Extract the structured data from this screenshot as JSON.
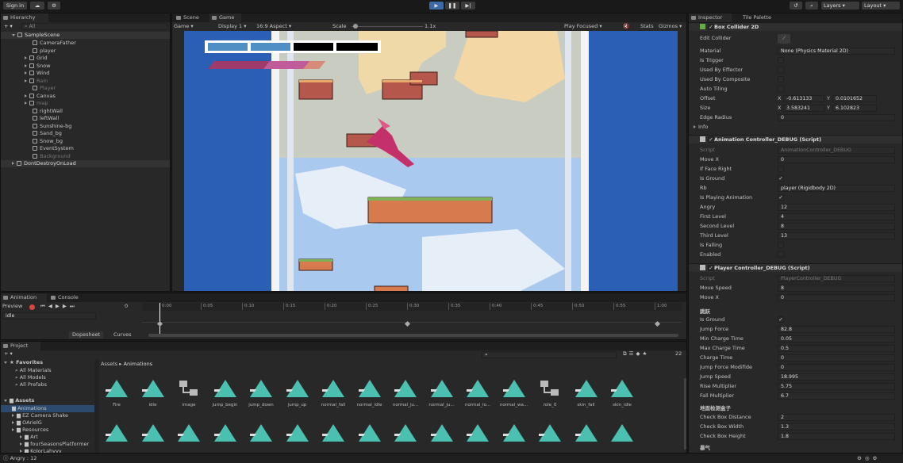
{
  "toolbar": {
    "signin": "Sign in",
    "layers": "Layers",
    "layout": "Layout"
  },
  "hierarchy": {
    "tab": "Hierarchy",
    "search": "All",
    "scene": "SampleScene",
    "items": [
      "CameraFather",
      "player",
      "Grid",
      "Snow",
      "Wind",
      "Rain",
      "Player",
      "Canvas",
      "map",
      "rightWall",
      "leftWall",
      "Sunshine-bg",
      "Sand_bg",
      "Snow_bg",
      "EventSystem",
      "Background"
    ],
    "dont_destroy": "DontDestroyOnLoad"
  },
  "game": {
    "tab_scene": "Scene",
    "tab_game": "Game",
    "mode": "Game",
    "display": "Display 1",
    "aspect": "16:9 Aspect",
    "scale_label": "Scale",
    "scale_value": "1.1x",
    "play_focused": "Play Focused",
    "stats": "Stats",
    "gizmos": "Gizmos"
  },
  "animation": {
    "tab_anim": "Animation",
    "tab_console": "Console",
    "preview": "Preview",
    "frame": "0",
    "clip": "idle",
    "ticks": [
      "0:00",
      "0:05",
      "0:10",
      "0:15",
      "0:20",
      "0:25",
      "0:30",
      "0:35",
      "0:40",
      "0:45",
      "0:50",
      "0:55",
      "1:00"
    ],
    "dopesheet": "Dopesheet",
    "curves": "Curves"
  },
  "project": {
    "tab": "Project",
    "count": "22",
    "favorites": "Favorites",
    "fav_items": [
      "All Materials",
      "All Models",
      "All Prefabs"
    ],
    "assets": "Assets",
    "tree": [
      "Animations",
      "EZ Camera Shake",
      "OArielG",
      "Resources",
      "Art",
      "fourSeasonsPlatformer",
      "KolorLahyyy"
    ],
    "breadcrumb_root": "Assets",
    "breadcrumb_leaf": "Animations",
    "asset_names": [
      "Fire",
      "idle",
      "image",
      "jump_begin",
      "jump_down",
      "jump_up",
      "normal_fall",
      "normal_idle",
      "normal_ju...",
      "normal_ju...",
      "normal_lo...",
      "normal_wa...",
      "role_0",
      "skin_fall",
      "skin_idle"
    ]
  },
  "inspector": {
    "tab": "Inspector",
    "tab2": "Tile Palette",
    "box_collider": {
      "title": "Box Collider 2D",
      "edit": "Edit Collider",
      "material_label": "Material",
      "material": "None (Physics Material 2D)",
      "is_trigger": "Is Trigger",
      "used_effector": "Used By Effector",
      "used_composite": "Used By Composite",
      "auto_tiling": "Auto Tiling",
      "offset": "Offset",
      "offset_x": "-0.613133",
      "offset_y": "0.0101652",
      "size": "Size",
      "size_x": "3.583241",
      "size_y": "6.102823",
      "edge_radius": "Edge Radius",
      "edge_radius_v": "0",
      "info": "Info"
    },
    "anim_ctrl": {
      "title": "Animation Controller_DEBUG (Script)",
      "script_label": "Script",
      "script": "AnimationController_DEBUG",
      "fields": [
        {
          "label": "Move X",
          "value": "0"
        },
        {
          "label": "If Face Right",
          "value": ""
        },
        {
          "label": "Is Ground",
          "value": "✓"
        },
        {
          "label": "Rb",
          "value": "player (Rigidbody 2D)"
        },
        {
          "label": "Is Playing Animation",
          "value": "✓"
        },
        {
          "label": "Angry",
          "value": "12"
        },
        {
          "label": "First Level",
          "value": "4"
        },
        {
          "label": "Second Level",
          "value": "8"
        },
        {
          "label": "Third Level",
          "value": "13"
        },
        {
          "label": "Is Falling",
          "value": ""
        },
        {
          "label": "Enabled",
          "value": ""
        }
      ]
    },
    "player_ctrl": {
      "title": "Player Controller_DEBUG (Script)",
      "script_label": "Script",
      "script": "PlayerController_DEBUG",
      "fields": [
        {
          "label": "Move Speed",
          "value": "8"
        },
        {
          "label": "Move X",
          "value": "0"
        }
      ],
      "section_jump": "跳跃",
      "jump_fields": [
        {
          "label": "Is Ground",
          "value": "✓"
        },
        {
          "label": "Jump Force",
          "value": "82.8"
        },
        {
          "label": "Min Charge Time",
          "value": "0.05"
        },
        {
          "label": "Max Charge Time",
          "value": "0.5"
        },
        {
          "label": "Charge Time",
          "value": "0"
        },
        {
          "label": "Jump Force Modifide",
          "value": "0"
        },
        {
          "label": "Jump Speed",
          "value": "18.995"
        },
        {
          "label": "Rise Multiplier",
          "value": "5.75"
        },
        {
          "label": "Fall Multiplier",
          "value": "6.7"
        }
      ],
      "section_ground": "地面检测盒子",
      "ground_fields": [
        {
          "label": "Check Box Distance",
          "value": "2"
        },
        {
          "label": "Check Box Width",
          "value": "1.3"
        },
        {
          "label": "Check Box Height",
          "value": "1.8"
        }
      ],
      "section_wind": "暴气"
    }
  },
  "status": {
    "text": "Angry : 12"
  }
}
